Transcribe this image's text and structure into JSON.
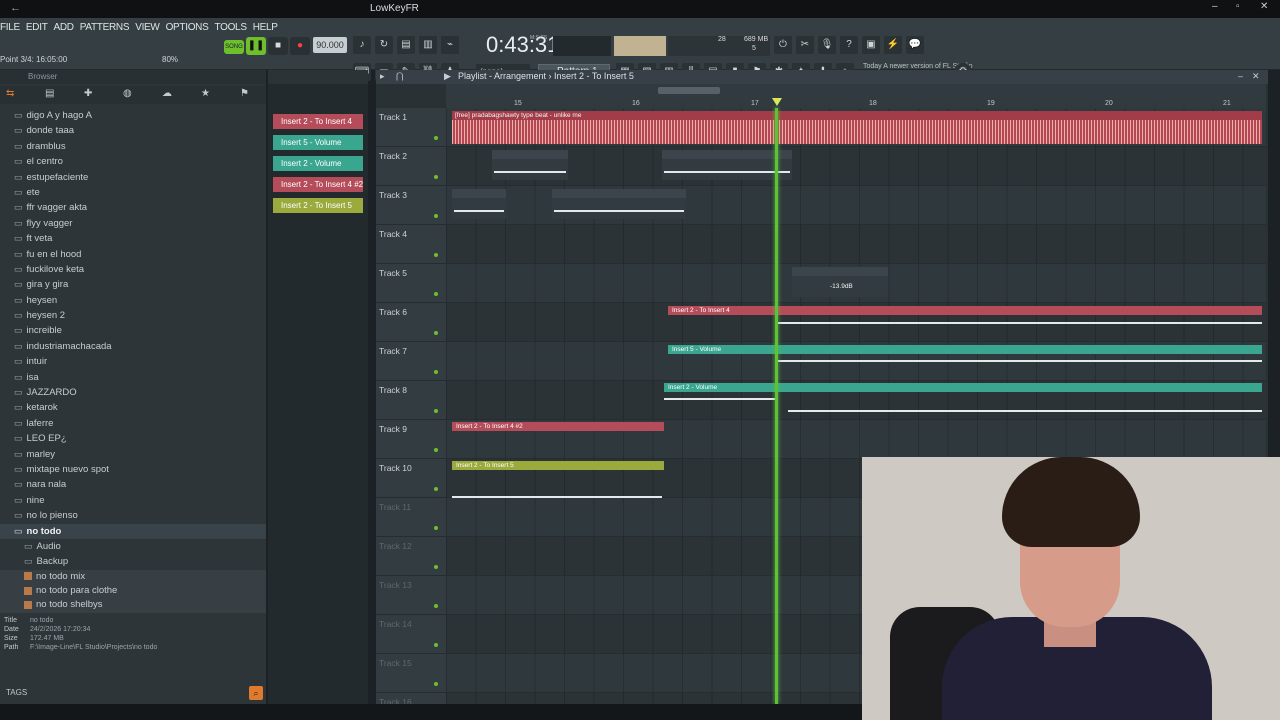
{
  "window": {
    "title": "LowKeyFR"
  },
  "menu": [
    "FILE",
    "EDIT",
    "ADD",
    "PATTERNS",
    "VIEW",
    "OPTIONS",
    "TOOLS",
    "HELP"
  ],
  "hint": "Point 3/4: 16:05:00",
  "hint_pct": "80%",
  "song_label": "SONG",
  "tempo": "90.000",
  "time": "0:43:31",
  "time_label": "M:S:CS",
  "cpu": {
    "v1": "28",
    "v2": "689 MB",
    "v3": "5"
  },
  "pattern": "Pattern 1",
  "none": "(none)",
  "news": "Today  A newer version of FL Studio is available!",
  "browser": {
    "header": "Browser",
    "items": [
      "digo A y hago A",
      "donde taaa",
      "dramblus",
      "el centro",
      "estupefaciente",
      "ete",
      "ffr vagger akta",
      "flyy vagger",
      "ft veta",
      "fu en el hood",
      "fuckilove keta",
      "gira y gira",
      "heysen",
      "heysen 2",
      "increible",
      "industriamachacada",
      "intuir",
      "isa",
      "JAZZARDO",
      "ketarok",
      "laferre",
      "LEO EP¿",
      "marley",
      "mixtape nuevo spot",
      "nara nala",
      "nine",
      "no lo pienso"
    ],
    "selected": "no todo",
    "children": [
      "Audio",
      "Backup"
    ],
    "files": [
      "no todo mix",
      "no todo para clothe",
      "no todo shelbys"
    ]
  },
  "info": {
    "title_k": "Title",
    "title_v": "no todo",
    "date_k": "Date",
    "date_v": "24/2/2026 17:20:34",
    "size_k": "Size",
    "size_v": "172.47 MB",
    "path_k": "Path",
    "path_v": "F:\\Image-Line\\FL Studio\\Projects\\no todo"
  },
  "tags": "TAGS",
  "cliplist": [
    "Insert 2 - To Insert 4",
    "Insert 5 - Volume",
    "Insert 2 - Volume",
    "Insert 2 - To Insert 4 #2",
    "Insert 2 - To Insert 5"
  ],
  "playlist": {
    "title": "Playlist - Arrangement › Insert 2 - To Insert 5",
    "ruler": [
      "15",
      "16",
      "17",
      "18",
      "19",
      "20",
      "21"
    ],
    "tracks": [
      "Track 1",
      "Track 2",
      "Track 3",
      "Track 4",
      "Track 5",
      "Track 6",
      "Track 7",
      "Track 8",
      "Track 9",
      "Track 10",
      "Track 11",
      "Track 12",
      "Track 13",
      "Track 14",
      "Track 15",
      "Track 16"
    ],
    "clips": {
      "audio1": "[free] pradabagshawty type beat - unlike me",
      "t2a": "untitled_2_3_Insert 1",
      "t2b": "untitled_2026-04-12 12-39-56_Insert 1",
      "t3a": "untitle_sert 1",
      "t3b": "untitled_2026-04-12 12-39-17_Insert 1",
      "t5": "untitled_2026_6_Insert 1 #2",
      "t5db": "-13.9dB",
      "t6": "Insert 2 - To Insert 4",
      "t7": "Insert 5 - Volume",
      "t8": "Insert 2 - Volume",
      "t9": "Insert 2 - To Insert 4 #2",
      "t10": "Insert 2 - To Insert 5"
    }
  },
  "colors": {
    "accent_green": "#6fbf2c",
    "clip_red": "#b54c5a",
    "clip_teal": "#3aa68f",
    "clip_olive": "#9aaa3c"
  }
}
